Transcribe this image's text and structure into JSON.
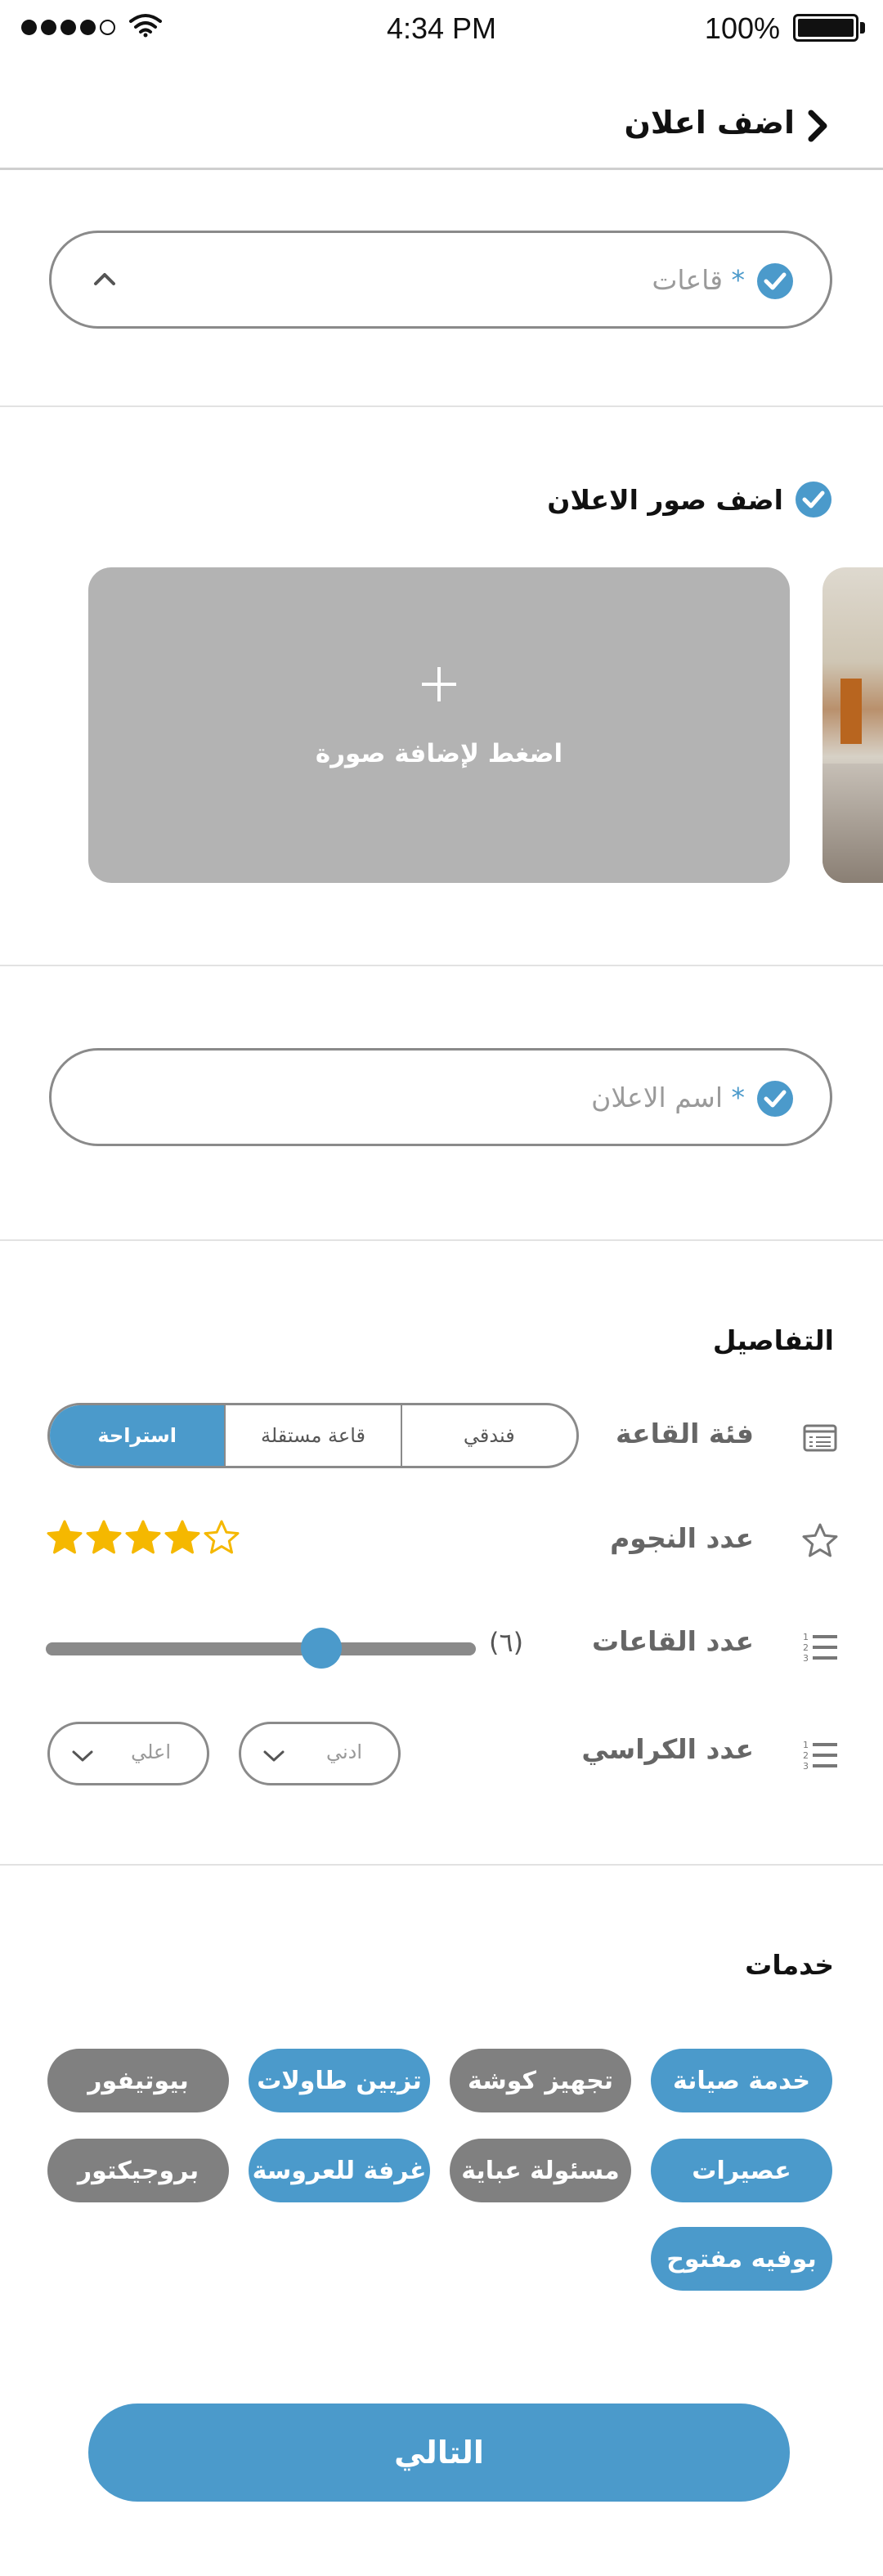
{
  "status_bar": {
    "time": "4:34 PM",
    "battery": "100%"
  },
  "header": {
    "title": "اضف اعلان"
  },
  "category_field": {
    "label": "قاعات",
    "required_mark": "*"
  },
  "photos": {
    "heading": "اضف صور الاعلان",
    "add_label": "اضغط لإضافة صورة"
  },
  "ad_name_field": {
    "label": "اسم الاعلان",
    "required_mark": "*"
  },
  "details": {
    "heading": "التفاصيل",
    "hall_class": {
      "label": "فئة القاعة",
      "options": [
        "فندقي",
        "قاعة مستقلة",
        "استراحة"
      ],
      "selected": "استراحة"
    },
    "stars": {
      "label": "عدد النجوم",
      "value": 4,
      "max": 5
    },
    "halls": {
      "label": "عدد القاعات",
      "value_text": "(٦)",
      "slider_fraction": 0.64
    },
    "chairs": {
      "label": "عدد الكراسي",
      "min_label": "ادني",
      "max_label": "اعلي"
    }
  },
  "services": {
    "heading": "خدمات",
    "chips": [
      {
        "label": "خدمة صيانة",
        "selected": true
      },
      {
        "label": "تجهيز كوشة",
        "selected": false
      },
      {
        "label": "تزيين طاولات",
        "selected": true
      },
      {
        "label": "بيوتيفور",
        "selected": false
      },
      {
        "label": "عصيرات",
        "selected": true
      },
      {
        "label": "مسئولة عباية",
        "selected": false
      },
      {
        "label": "غرفة للعروسة",
        "selected": true
      },
      {
        "label": "بروجيكتور",
        "selected": false
      },
      {
        "label": "بوفيه مفتوح",
        "selected": true
      }
    ]
  },
  "next_button": {
    "label": "التالي"
  },
  "colors": {
    "accent": "#4b9acb",
    "chip_gray": "#808080",
    "photo_placeholder": "#b3b3b3",
    "star": "#f5b800"
  },
  "icons": [
    "back-chevron-icon",
    "check-circle-icon",
    "chevron-up-icon",
    "plus-icon",
    "list-icon",
    "star-outline-icon",
    "ordered-list-icon",
    "chevron-down-icon"
  ]
}
